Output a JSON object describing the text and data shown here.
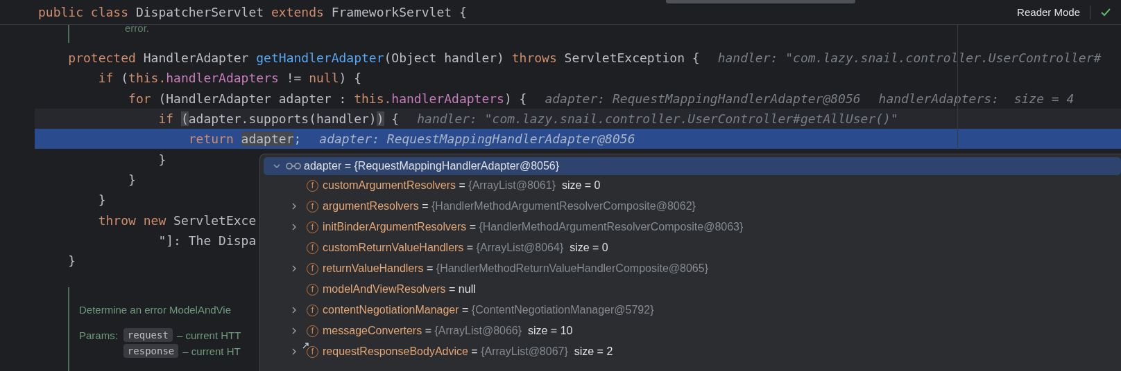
{
  "sticky_header": {
    "tokens": [
      {
        "kind": "keyword",
        "text": "public class "
      },
      {
        "kind": "plain",
        "text": "DispatcherServlet "
      },
      {
        "kind": "keyword",
        "text": "extends "
      },
      {
        "kind": "plain",
        "text": "FrameworkServlet {"
      }
    ]
  },
  "toolbar": {
    "reader_mode": "Reader Mode",
    "inspection_ok": true
  },
  "doc_fragment": "error.",
  "lines": [
    {
      "caret": false,
      "selected": false,
      "tokens": [
        {
          "kind": "keyword",
          "text": "    protected "
        },
        {
          "kind": "plain",
          "text": "HandlerAdapter "
        },
        {
          "kind": "method",
          "text": "getHandlerAdapter"
        },
        {
          "kind": "plain",
          "text": "(Object handler) "
        },
        {
          "kind": "keyword",
          "text": "throws "
        },
        {
          "kind": "plain",
          "text": "ServletException {"
        }
      ],
      "hints": [
        "handler: \"com.lazy.snail.controller.UserController#"
      ]
    },
    {
      "caret": false,
      "selected": false,
      "tokens": [
        {
          "kind": "keyword",
          "text": "        if "
        },
        {
          "kind": "plain",
          "text": "("
        },
        {
          "kind": "keyword",
          "text": "this."
        },
        {
          "kind": "field",
          "text": "handlerAdapters"
        },
        {
          "kind": "plain",
          "text": " != "
        },
        {
          "kind": "keyword",
          "text": "null"
        },
        {
          "kind": "plain",
          "text": ") {"
        }
      ]
    },
    {
      "caret": false,
      "selected": false,
      "tokens": [
        {
          "kind": "keyword",
          "text": "            for "
        },
        {
          "kind": "plain",
          "text": "(HandlerAdapter adapter : "
        },
        {
          "kind": "keyword",
          "text": "this."
        },
        {
          "kind": "field",
          "text": "handlerAdapters"
        },
        {
          "kind": "plain",
          "text": ") {"
        }
      ],
      "hints": [
        "adapter: RequestMappingHandlerAdapter@8056",
        "handlerAdapters:  size = 4"
      ]
    },
    {
      "caret": true,
      "selected": false,
      "tokens": [
        {
          "kind": "keyword",
          "text": "                if "
        },
        {
          "kind": "brace_match",
          "text": "("
        },
        {
          "kind": "plain",
          "text": "adapter.supports(handler)"
        },
        {
          "kind": "brace_match",
          "text": ")"
        },
        {
          "kind": "plain",
          "text": " {"
        }
      ],
      "hints": [
        "handler: \"com.lazy.snail.controller.UserController#getAllUser()\""
      ]
    },
    {
      "caret": false,
      "selected": true,
      "tokens": [
        {
          "kind": "keyword",
          "text": "                    return "
        },
        {
          "kind": "usage",
          "text": "adapter"
        },
        {
          "kind": "plain",
          "text": ";"
        }
      ],
      "hints": [
        "adapter: RequestMappingHandlerAdapter@8056"
      ]
    },
    {
      "caret": false,
      "selected": false,
      "tokens": [
        {
          "kind": "plain",
          "text": "                }"
        }
      ]
    },
    {
      "caret": false,
      "selected": false,
      "tokens": [
        {
          "kind": "plain",
          "text": "            }"
        }
      ]
    },
    {
      "caret": false,
      "selected": false,
      "tokens": [
        {
          "kind": "plain",
          "text": "        }"
        }
      ]
    },
    {
      "caret": false,
      "selected": false,
      "tokens": [
        {
          "kind": "keyword",
          "text": "        throw new "
        },
        {
          "kind": "plain",
          "text": "ServletExce"
        }
      ]
    },
    {
      "caret": false,
      "selected": false,
      "tokens": [
        {
          "kind": "plain",
          "text": "                \"]: The Dispa"
        }
      ]
    },
    {
      "caret": false,
      "selected": false,
      "tokens": [
        {
          "kind": "plain",
          "text": "    }"
        }
      ]
    }
  ],
  "doc": {
    "summary": "Determine an error ModelAndVie",
    "params_label": "Params:",
    "params": [
      {
        "name": "request",
        "desc": "– current HTT"
      },
      {
        "name": "response",
        "desc": "– current HT"
      }
    ]
  },
  "debug_popup": {
    "header": {
      "expanded": true,
      "selected": true,
      "name": "adapter",
      "op": "=",
      "value": "{RequestMappingHandlerAdapter@8056}"
    },
    "rows": [
      {
        "expandable": false,
        "icon": "f",
        "badge": false,
        "name": "customArgumentResolvers",
        "op": "=",
        "value": "{ArrayList@8061}",
        "extra": "size = 0"
      },
      {
        "expandable": true,
        "icon": "f",
        "badge": false,
        "name": "argumentResolvers",
        "op": "=",
        "value": "{HandlerMethodArgumentResolverComposite@8062}"
      },
      {
        "expandable": true,
        "icon": "f",
        "badge": false,
        "name": "initBinderArgumentResolvers",
        "op": "=",
        "value": "{HandlerMethodArgumentResolverComposite@8063}"
      },
      {
        "expandable": false,
        "icon": "f",
        "badge": false,
        "name": "customReturnValueHandlers",
        "op": "=",
        "value": "{ArrayList@8064}",
        "extra": "size = 0"
      },
      {
        "expandable": true,
        "icon": "f",
        "badge": false,
        "name": "returnValueHandlers",
        "op": "=",
        "value": "{HandlerMethodReturnValueHandlerComposite@8065}"
      },
      {
        "expandable": false,
        "icon": "f",
        "badge": false,
        "name": "modelAndViewResolvers",
        "op": "=",
        "extra": "null"
      },
      {
        "expandable": true,
        "icon": "f",
        "badge": false,
        "name": "contentNegotiationManager",
        "op": "=",
        "value": "{ContentNegotiationManager@5792}"
      },
      {
        "expandable": true,
        "icon": "f",
        "badge": false,
        "name": "messageConverters",
        "op": "=",
        "value": "{ArrayList@8066}",
        "extra": "size = 10"
      },
      {
        "expandable": true,
        "icon": "f",
        "badge": true,
        "name": "requestResponseBodyAdvice",
        "op": "=",
        "value": "{ArrayList@8067}",
        "extra": "size = 2"
      }
    ]
  }
}
